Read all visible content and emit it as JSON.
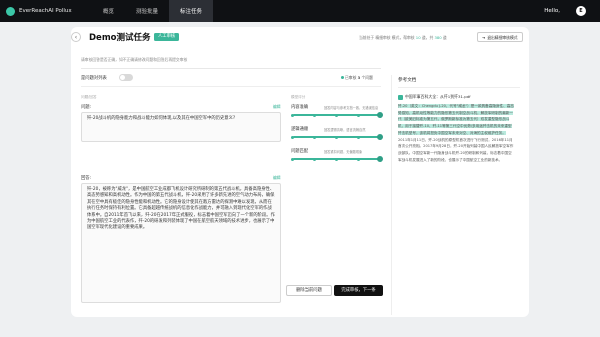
{
  "topbar": {
    "app_name": "EverReachAI Pollux",
    "nav": [
      "概览",
      "测验批量",
      "标注任务"
    ],
    "active_nav_index": 2,
    "greeting": "Hello,",
    "avatar_letter": "E"
  },
  "header": {
    "back_icon": "chevron-left-icon",
    "title": "Demo测试任务",
    "badge": "人工审核",
    "stat_prefix": "当前处于 ",
    "stat_mode": "精细审核",
    "stat_mid": " 模式，帮审核 ",
    "stat_done": "10",
    "stat_mid2": " 道，共 ",
    "stat_total": "380",
    "stat_suffix": " 道",
    "exit_label": "退出精细审核模式",
    "exit_icon": "exit-icon"
  },
  "task": {
    "instructions": "请审核回答是否正确，如不正确请修改问题和回答后再提交审核",
    "toggle_label": "是问题对列表",
    "toggle_on": false,
    "legend_label": "已审核",
    "legend_count": "3",
    "legend_unit": "个问题"
  },
  "qa": {
    "section_head": "问题/回答",
    "question_label": "问题:",
    "question_edit": "编辑",
    "question_text": "歼-20战斗机的隐身能力和战斗能力如何体现,以及其在中国空军中的历史意义?",
    "answer_label": "回答:",
    "answer_edit": "编辑",
    "answer_text": "歼-20，被称为\"威龙\"，是中国航空工业成都飞机设计研究所研制的第五代战斗机，具备高隐身性、高态势感知和高机动性。作为中国的第五代战斗机，歼-20采用了许多新先进的空气动力布局，确保其在空中具有极佳的隐身性能和机动性。它的隐身设计使其在敌方雷达的探测中难以发现，从而在执行任务时保持有利位置。它具备超越传统战机的信息化作战能力，并可融入到现代化空军的作战体系中。自2011年首飞以来，歼-20在2017年正式服役，标志着中国空军迈向了一个新的阶段。作为中国航空工业的代表作，歼-20的研发和列装体现了中国在航空航天领域的技术进步，也展示了中国空军现代化建设的重要成果。"
  },
  "scores": {
    "section_head": "模型评分",
    "items": [
      {
        "label": "内容准确",
        "hint": "回答内容与参考文档一致，无错误信息",
        "value": 1.0
      },
      {
        "label": "逻辑通顺",
        "hint": "回答逻辑清晰，语言流畅自然",
        "value": 1.0
      },
      {
        "label": "问题匹配",
        "hint": "回答紧扣问题，无偏题现象",
        "value": 1.0
      }
    ]
  },
  "reference": {
    "title": "参考文档",
    "doc_icon": "document-icon",
    "doc_name": "中国军事百科大全：从歼1到歼31.pdf",
    "highlight": "歼-20（英文：Chengdu J-20，代号\"威龙\"）是一款具备高隐身性、高态势感知、高机动性等能力的隐形第五代制空战斗机，解放军研制的最新一代（欧美旧标准为第五代，俄罗斯新标准为第五代）双发重型隐形战斗机，用于接替歼-10、歼-11等第三代空中优势/多用途歼击机的未来重型歼击机型号，该机将担负中国空军未来对空、对海的主权维护任务。",
    "rest": "2011年1月11日，歼-20战机的原型机首次进行飞行测试，2016年11月首次公开亮相。2017年9月28日，歼-20开始列装中国人民解放军空军作战部队。中国空军新一代隐身战斗机歼-20的研制和列装，标志着中国空军战斗机发展进入了新的阶段，也展示了中国航空工业的新技术。"
  },
  "actions": {
    "skip_label": "删除当前问题",
    "next_label": "完成审核，下一条"
  }
}
